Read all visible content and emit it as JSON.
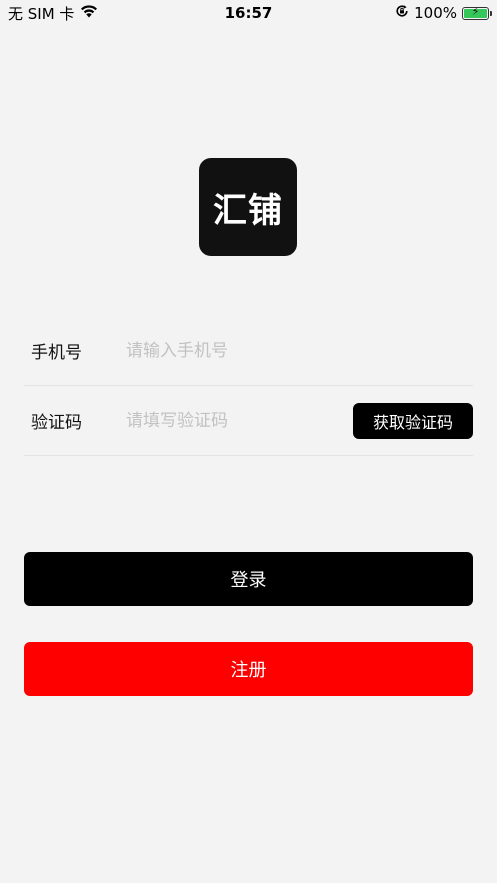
{
  "status_bar": {
    "carrier": "无 SIM 卡",
    "time": "16:57",
    "battery_percent": "100%",
    "battery_level": 1.0,
    "icons": [
      "wifi-icon",
      "orientation-lock-icon",
      "battery-icon",
      "charging-bolt-icon"
    ]
  },
  "logo": {
    "text": "汇铺"
  },
  "form": {
    "phone": {
      "label": "手机号",
      "placeholder": "请输入手机号",
      "value": ""
    },
    "code": {
      "label": "验证码",
      "placeholder": "请填写验证码",
      "value": "",
      "button_label": "获取验证码"
    }
  },
  "buttons": {
    "login_label": "登录",
    "register_label": "注册"
  },
  "colors": {
    "background": "#f3f3f3",
    "primary": "#000000",
    "register": "#fe0000",
    "battery": "#35c759"
  }
}
